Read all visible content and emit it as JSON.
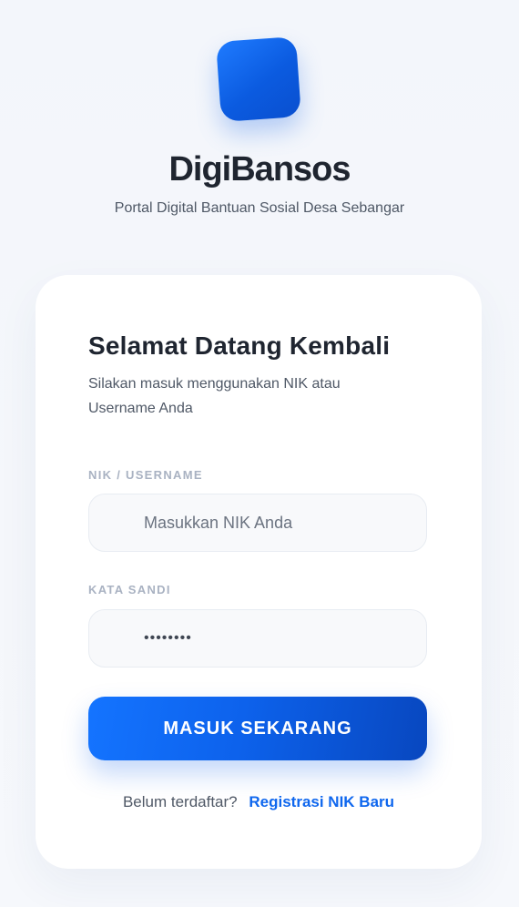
{
  "brand": {
    "title": "DigiBansos",
    "subtitle": "Portal Digital Bantuan Sosial Desa Sebangar",
    "logo_color": "#0b5be0"
  },
  "login_card": {
    "heading": "Selamat Datang Kembali",
    "description": "Silakan masuk menggunakan NIK atau Username Anda",
    "nik_field": {
      "label": "NIK / USERNAME",
      "placeholder": "Masukkan NIK Anda",
      "value": ""
    },
    "password_field": {
      "label": "KATA SANDI",
      "value": "••••••••"
    },
    "submit_label": "MASUK SEKARANG",
    "register_prompt": "Belum terdaftar?",
    "register_link": "Registrasi NIK Baru"
  },
  "colors": {
    "accent": "#0d62ec",
    "link": "#0f67ee",
    "background": "#f4f7fb"
  }
}
